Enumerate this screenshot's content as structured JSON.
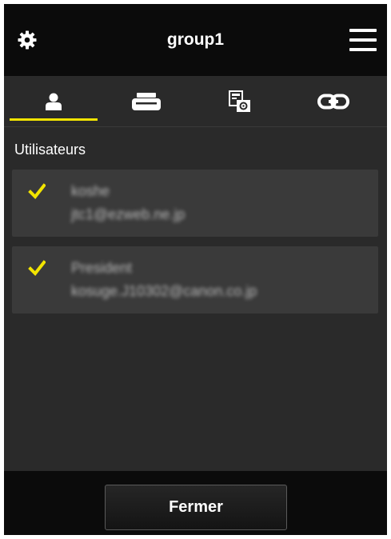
{
  "header": {
    "title": "group1",
    "settings_icon": "gear-icon",
    "menu_icon": "hamburger-menu-icon"
  },
  "tabs": [
    {
      "icon": "user-icon",
      "active": true
    },
    {
      "icon": "printer-icon",
      "active": false
    },
    {
      "icon": "app-settings-icon",
      "active": false
    },
    {
      "icon": "link-icon",
      "active": false
    }
  ],
  "users_section": {
    "label": "Utilisateurs",
    "users": [
      {
        "name": "koshe",
        "email": "jtc1@ezweb.ne.jp",
        "checked": true
      },
      {
        "name": "President",
        "email": "kosuge.J10302@canon.co.jp",
        "checked": true
      }
    ]
  },
  "footer": {
    "close_label": "Fermer"
  },
  "colors": {
    "accent": "#f2e400",
    "background": "#2a2a2a",
    "bar": "#0b0b0b",
    "row": "#3a3a3a"
  }
}
